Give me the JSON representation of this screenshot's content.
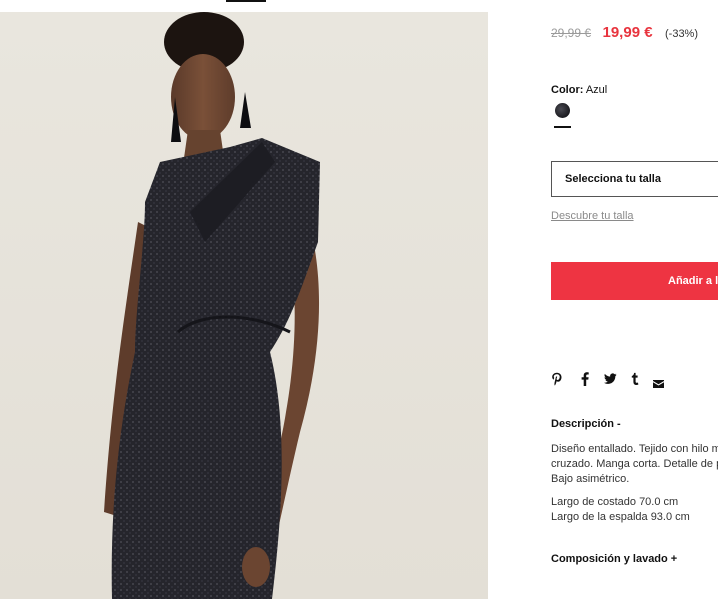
{
  "product": {
    "old_price": "29,99 €",
    "price": "19,99 €",
    "discount": "(-33%)",
    "color_label": "Color:",
    "color_value": "Azul",
    "size_select": "Selecciona tu talla",
    "size_guide": "Descubre tu talla",
    "add_button": "Añadir a la cesta",
    "description_title": "Descripción -",
    "description_lines": [
      "Diseño entallado. Tejido con hilo metalizado. Cuello",
      "cruzado. Manga corta. Detalle de pliegues en la cintura.",
      "Bajo asimétrico."
    ],
    "measure_side": "Largo de costado 70.0 cm",
    "measure_back": "Largo de la espalda 93.0 cm",
    "composition_title": "Composición y lavado +"
  },
  "share_icons": [
    "pinterest-icon",
    "facebook-icon",
    "twitter-icon",
    "tumblr-icon",
    "mail-icon"
  ],
  "colors": {
    "accent_red": "#ee3442",
    "price_red": "#e8343e",
    "swatch": "#1b1b20"
  }
}
